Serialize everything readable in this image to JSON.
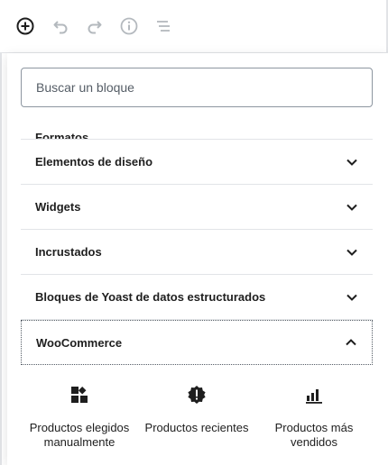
{
  "toolbar": {
    "add_icon": "plus-circle-icon",
    "undo_icon": "undo-icon",
    "redo_icon": "redo-icon",
    "info_icon": "info-icon",
    "outline_icon": "list-outline-icon"
  },
  "inserter": {
    "search": {
      "placeholder": "Buscar un bloque",
      "value": ""
    },
    "categories": [
      {
        "label": "Formatos"
      },
      {
        "label": "Elementos de diseño"
      },
      {
        "label": "Widgets"
      },
      {
        "label": "Incrustados"
      },
      {
        "label": "Bloques de Yoast de datos estructurados"
      },
      {
        "label": "WooCommerce"
      }
    ],
    "woocommerce_blocks": [
      {
        "label": "Productos elegidos manualmente",
        "icon": "grid-icon"
      },
      {
        "label": "Productos recientes",
        "icon": "badge-exclamation-icon"
      },
      {
        "label": "Productos más vendidos",
        "icon": "bar-chart-icon"
      }
    ]
  },
  "colors": {
    "text": "#1e1e1e",
    "icon_muted": "#b4b9be",
    "border": "#e2e4e7",
    "search_border": "#8d96a0"
  }
}
